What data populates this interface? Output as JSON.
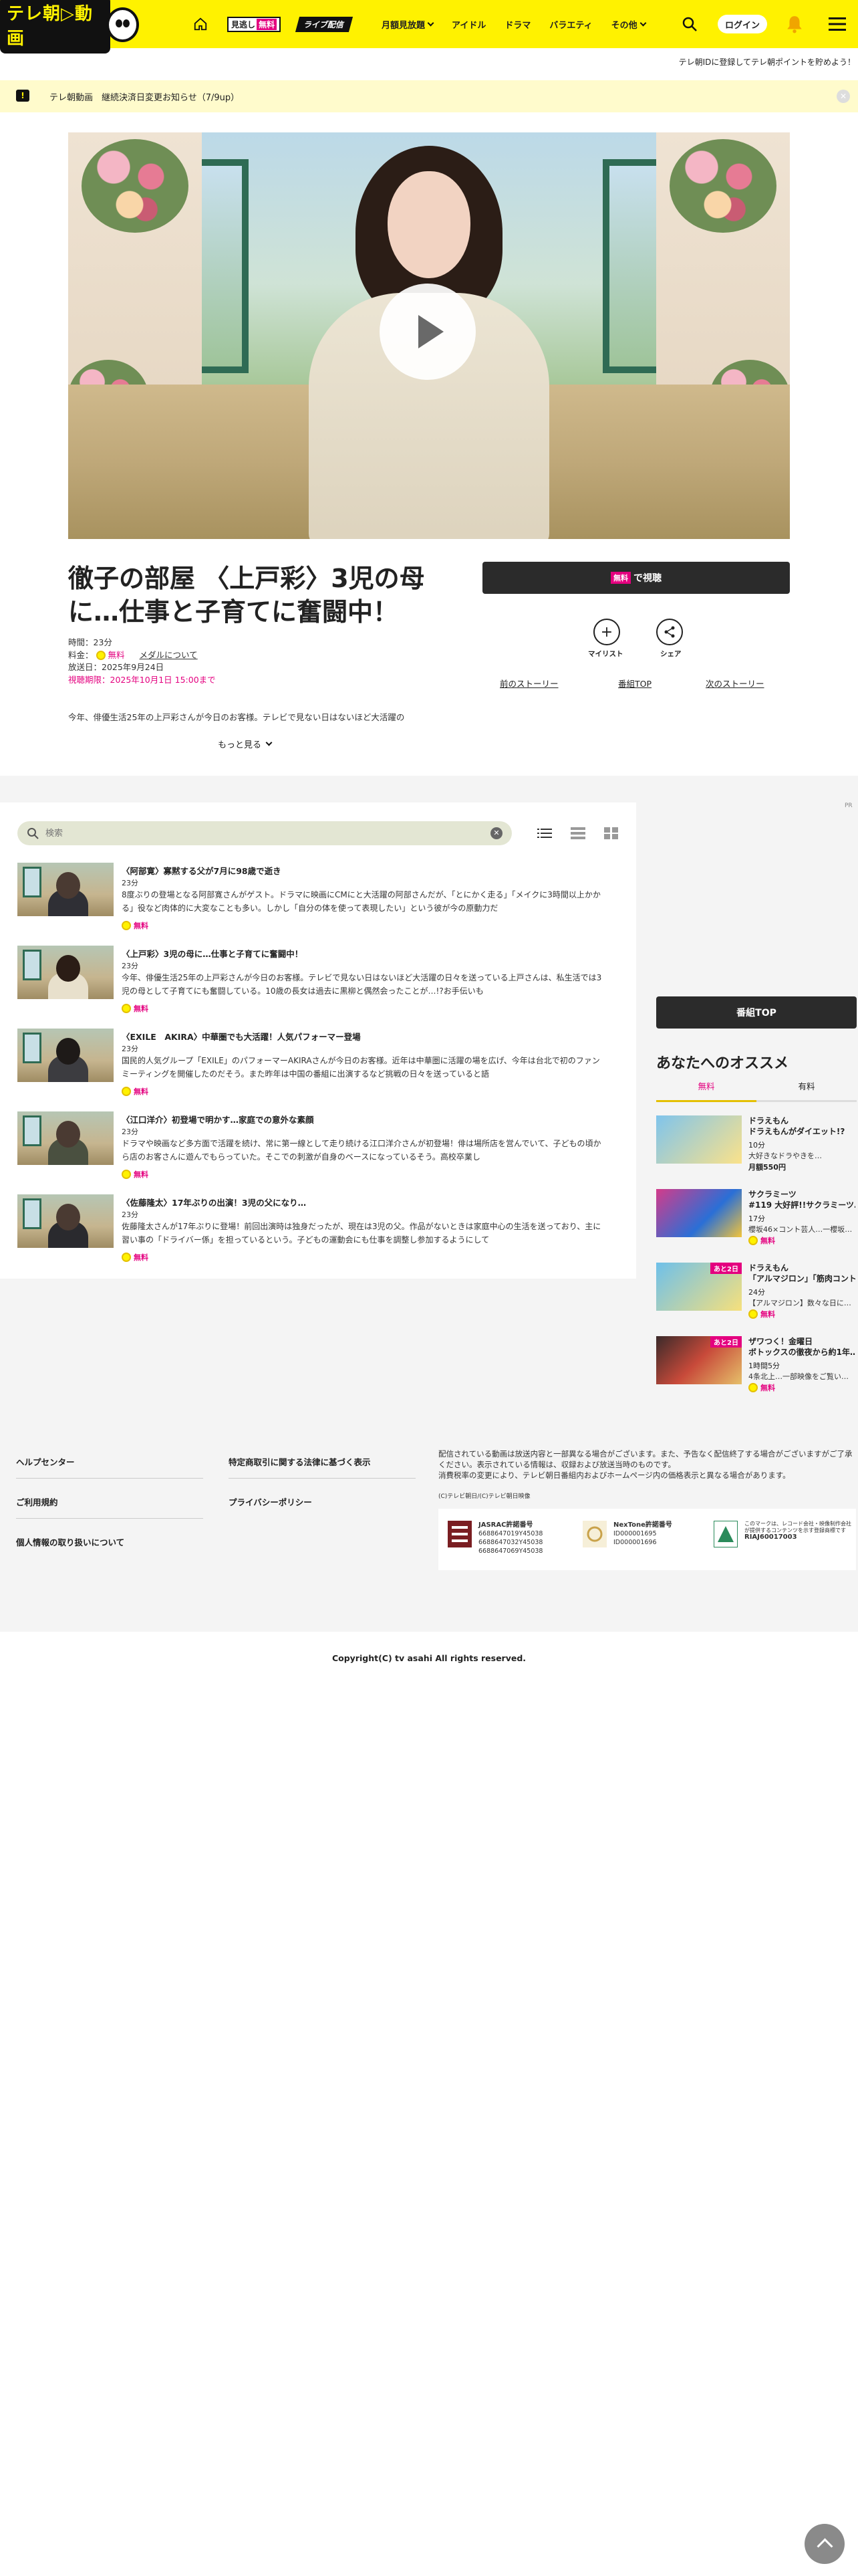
{
  "header": {
    "logo_text": "テレ朝▷動画",
    "home_label": "⌂",
    "free_badge": {
      "left": "見逃し",
      "right": "無料"
    },
    "live_badge": "ライブ配信",
    "nav_links": [
      "月額見放題",
      "アイドル",
      "ドラマ",
      "バラエティ",
      "その他"
    ],
    "login_label": "ログイン"
  },
  "sub_bar": "テレ朝IDに登録してテレ朝ポイントを貯めよう！",
  "notice": {
    "text": "テレ朝動画　継続決済日変更お知らせ（7/9up）",
    "close": "✕"
  },
  "episode": {
    "title": "徹子の部屋 〈上戸彩〉3児の母に…仕事と子育てに奮闘中！",
    "duration": "時間：23分",
    "price_label": "料金：",
    "price_value": "無料",
    "medal_link": "メダルについて",
    "aired": "放送日：2025年9月24日",
    "deadline": "視聴期限：2025年10月1日 15:00まで",
    "desc": "今年、俳優生活25年の上戸彩さんが今日のお客様。テレビで見ない日はないほど大活躍の",
    "more_label": "もっと見る"
  },
  "actions": {
    "watch_free": "無料",
    "watch_label": "で視聴",
    "mylist": "マイリスト",
    "share": "シェア",
    "prev_story": "前のストーリー",
    "program_top": "番組TOP",
    "next_story": "次のストーリー"
  },
  "list": {
    "pr": "PR",
    "search_placeholder": "検索",
    "items": [
      {
        "name": "〈阿部寛〉寡黙する父が7月に98歳で逝き",
        "duration": "23分",
        "desc": "8度ぶりの登場となる阿部寛さんがゲスト。ドラマに映画にCMにと大活躍の阿部さんだが、「とにかく走る」「メイクに3時間以上かかる」役など肉体的に大変なことも多い。しかし「自分の体を使って表現したい」という彼が今の原動力だ",
        "free": "無料"
      },
      {
        "name": "〈上戸彩〉3児の母に…仕事と子育てに奮闘中！",
        "duration": "23分",
        "desc": "今年、俳優生活25年の上戸彩さんが今日のお客様。テレビで見ない日はないほど大活躍の日々を送っている上戸さんは、私生活では3児の母として子育てにも奮闘している。10歳の長女は過去に黒柳と偶然会ったことが…!?お手伝いも",
        "free": "無料"
      },
      {
        "name": "〈EXILE　AKIRA〉中華圏でも大活躍！人気パフォーマー登場",
        "duration": "23分",
        "desc": "国民的人気グループ「EXILE」のパフォーマーAKIRAさんが今日のお客様。近年は中華圏に活躍の場を広げ、今年は台北で初のファンミーティングを開催したのだそう。また昨年は中国の番組に出演するなど挑戦の日々を送っていると語",
        "free": "無料"
      },
      {
        "name": "〈江口洋介〉初登場で明かす…家庭での意外な素顔",
        "duration": "23分",
        "desc": "ドラマや映画など多方面で活躍を続け、常に第一線として走り続ける江口洋介さんが初登場！俳は場所店を営んでいて、子どもの頃から店のお客さんに遊んでもらっていた。そこでの刺激が自身のベースになっているそう。高校卒業し",
        "free": "無料"
      },
      {
        "name": "〈佐藤隆太〉17年ぶりの出演！3児の父になり…",
        "duration": "23分",
        "desc": "佐藤隆太さんが17年ぶりに登場！前回出演時は独身だったが、現在は3児の父。作品がないときは家庭中心の生活を送っており、主に習い事の「ドライバー係」を担っているという。子どもの運動会にも仕事を調整し参加するようにして",
        "free": "無料"
      }
    ]
  },
  "right": {
    "program_top": "番組TOP",
    "rec_title": "あなたへのオススメ",
    "tabs": [
      "無料",
      "有料"
    ],
    "items": [
      {
        "name": "ドラえもん",
        "sub": "ドラえもんがダイエット!?",
        "duration": "10分",
        "desc": "大好きなドラやきを…",
        "price": "月額550円",
        "tag": ""
      },
      {
        "name": "サクラミーツ",
        "sub": "#119 大好評!!サクラミーツ…",
        "duration": "17分",
        "desc": "櫻坂46×コント芸人…一櫻坂…",
        "price": "無料",
        "tag": ""
      },
      {
        "name": "ドラえもん",
        "sub": "「アルマジロン」「筋肉コント…",
        "duration": "24分",
        "desc": "【アルマジロン】数々な日に…",
        "price": "無料",
        "tag": "あと2日"
      },
      {
        "name": "ザワつく！金曜日",
        "sub": "ボトックスの徹夜から約1年…",
        "duration": "1時間5分",
        "desc": "4条北上…一部映像をご覧い…",
        "price": "無料",
        "tag": "あと2日"
      }
    ]
  },
  "footer": {
    "links": [
      "ヘルプセンター",
      "ご利用規約",
      "個人情報の取り扱いについて",
      "特定商取引に関する法律に基づく表示",
      "プライバシーポリシー"
    ],
    "note": "配信されている動画は放送内容と一部異なる場合がございます。また、予告なく配信終了する場合がございますがご了承ください。表示されている情報は、収録および放送当時のものです。",
    "note2": "消費税率の変更により、テレビ朝日番組内およびホームページ内の価格表示と異なる場合があります。",
    "small": "(C)テレビ朝日/(C)テレビ朝日映像",
    "jasrac": {
      "title": "JASRAC許諾番号",
      "nums": [
        "6688647019Y45038",
        "6688647032Y45038",
        "6688647069Y45038"
      ]
    },
    "nextone": {
      "title": "NexTone許諾番号",
      "nums": [
        "ID000001695",
        "ID000001696"
      ]
    },
    "riaj": {
      "desc": "このマークは、レコード会社・映像制作会社が提供するコンテンツを示す登録商標です",
      "num": "RIAJ60017003"
    },
    "copyright": "Copyright(C) tv asahi All rights reserved."
  }
}
